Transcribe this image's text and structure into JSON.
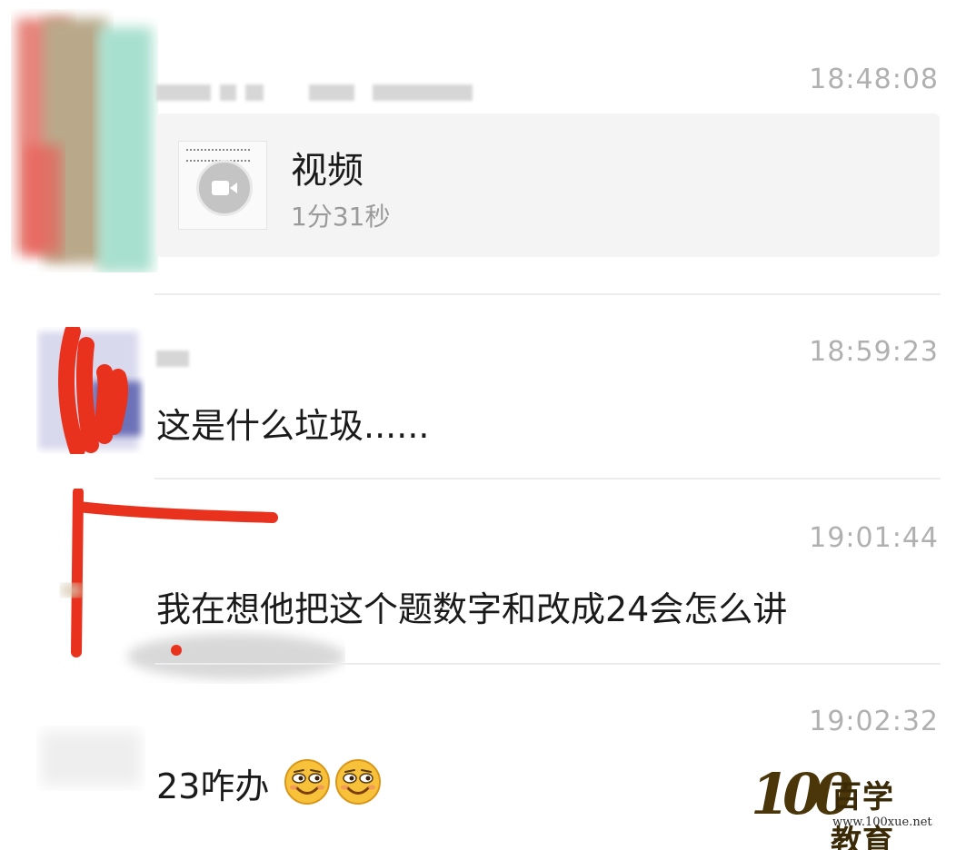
{
  "messages": [
    {
      "time": "18:48:08",
      "type": "video",
      "video": {
        "title": "视频",
        "duration": "1分31秒"
      }
    },
    {
      "time": "18:59:23",
      "type": "text",
      "text": "这是什么垃圾......"
    },
    {
      "time": "19:01:44",
      "type": "text",
      "text": "我在想他把这个题数字和改成24会怎么讲"
    },
    {
      "time": "19:02:32",
      "type": "text",
      "text": "23咋办",
      "emojis": [
        "grin-emoji",
        "grin-emoji"
      ]
    }
  ],
  "watermark": {
    "number": "100",
    "name": "百学教育",
    "url": "www.100xue.net"
  },
  "colors": {
    "redaction": "#e8321e",
    "timestamp": "#b0b0b0",
    "card": "#f4f4f4",
    "logo": "#4a3608"
  }
}
